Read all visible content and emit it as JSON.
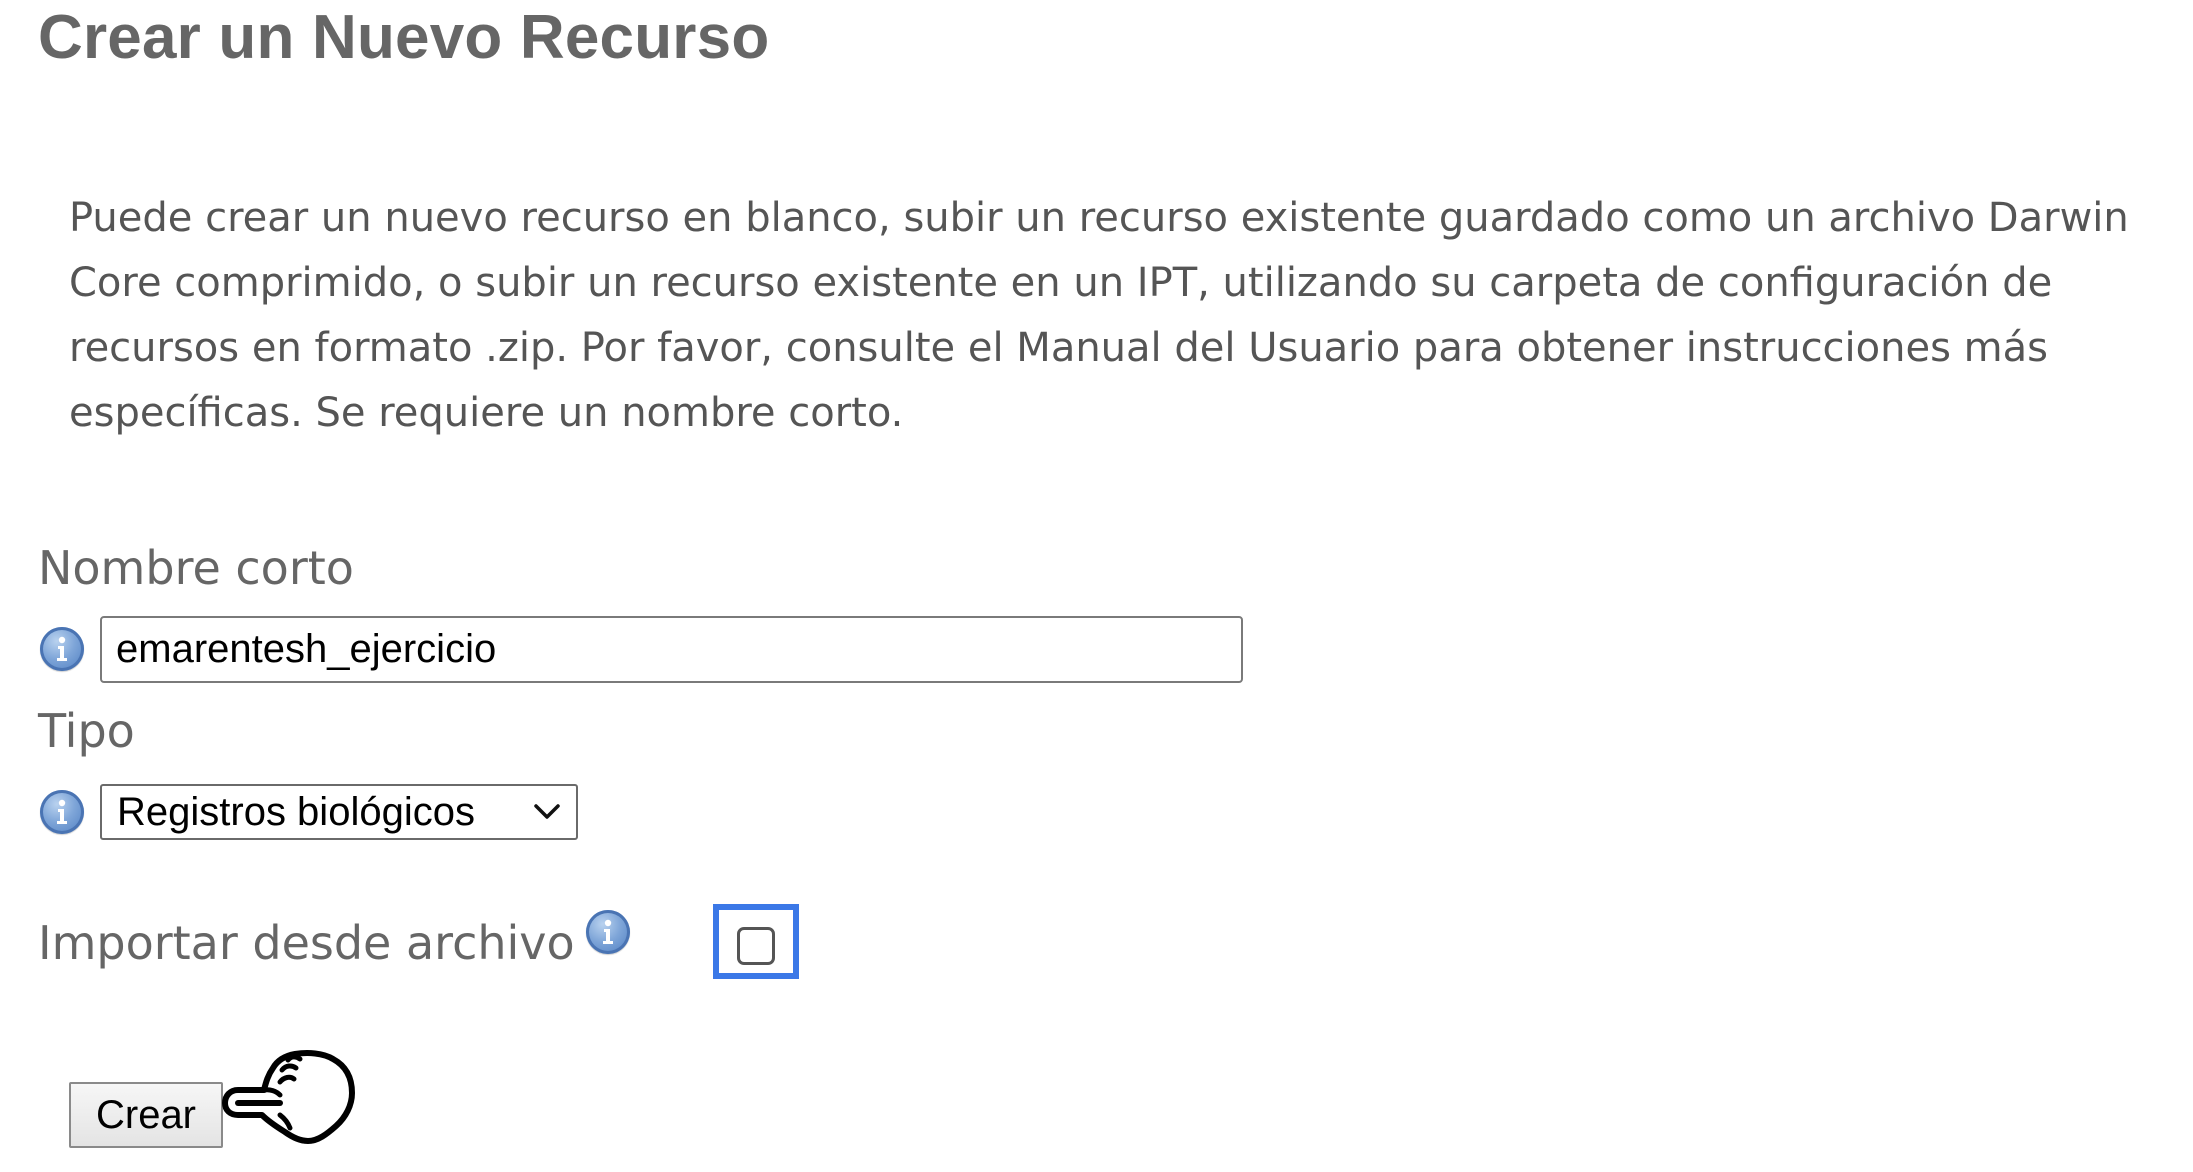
{
  "page": {
    "title": "Crear un Nuevo Recurso",
    "intro": "Puede crear un nuevo recurso en blanco, subir un recurso existente guardado como un archivo Darwin Core comprimido, o subir un recurso existente en un IPT, utilizando su carpeta de configuración de recursos en formato .zip. Por favor, consulte el Manual del Usuario para obtener instrucciones más específicas. Se requiere un nombre corto."
  },
  "form": {
    "shortname": {
      "label": "Nombre corto",
      "value": "emarentesh_ejercicio",
      "icon": "info-icon"
    },
    "type": {
      "label": "Tipo",
      "selected": "Registros biológicos",
      "icon": "info-icon"
    },
    "import": {
      "label": "Importar desde archivo",
      "checked": false,
      "icon": "info-icon",
      "focus_color": "#3b78e7"
    },
    "submit_label": "Crear",
    "pointer_icon": "pointing-hand-icon"
  },
  "colors": {
    "heading": "#666666",
    "text": "#555555",
    "info_icon": "#5b8bd0"
  }
}
